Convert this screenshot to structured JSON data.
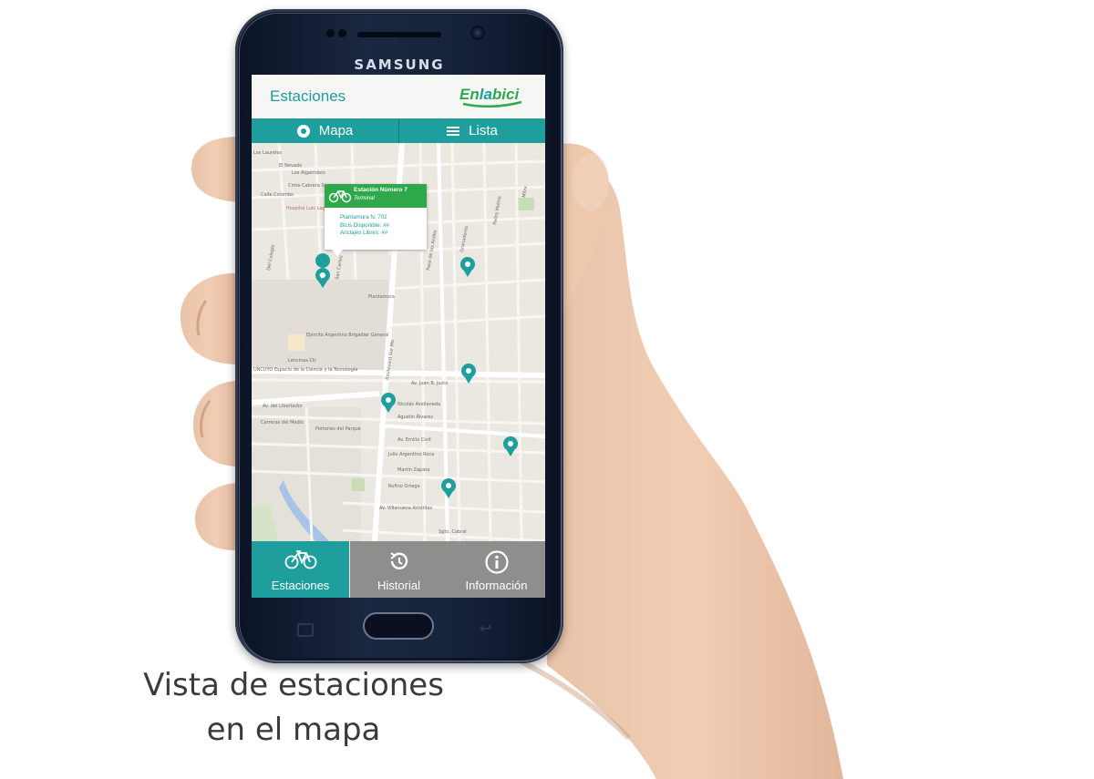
{
  "device": {
    "brand": "SAMSUNG"
  },
  "app": {
    "title": "Estaciones",
    "logo": {
      "part1": "En",
      "part2": "la",
      "part3": "bici"
    },
    "tabs": [
      {
        "label": "Mapa",
        "icon": "map-pin-icon",
        "active": true
      },
      {
        "label": "Lista",
        "icon": "list-icon",
        "active": false
      }
    ],
    "popup": {
      "title": "Estación Número 7",
      "subtitle": "Terminal",
      "address": "Plantamura N. 702",
      "bikes": "Bicis Disponible: ##",
      "docks": "Anclajes Libres: ##"
    },
    "bottom_nav": [
      {
        "label": "Estaciones",
        "icon": "bicycle-icon",
        "active": true
      },
      {
        "label": "Historial",
        "icon": "history-icon",
        "active": false
      },
      {
        "label": "Información",
        "icon": "info-icon",
        "active": false
      }
    ]
  },
  "map": {
    "streets": [
      "Los Laureles",
      "El Nevado",
      "Los Algarrobos",
      "Cmte Cabrera Sur",
      "Calle Colombo",
      "Hospital Luis Lagomaggiore",
      "Del Colegio",
      "San Carlos",
      "Plantamura",
      "Ejército Argentino Brigadier General",
      "Lencinas Ctr",
      "UNCUYO Espacio de la Ciencia y la Tecnología",
      "Av. del Libertador",
      "Carreras del Medio",
      "Portones del Parque",
      "Boulevard Sur Mo",
      "Paso de los Andes",
      "Av. Juan B. Justo",
      "Nicolás Avellaneda",
      "Agustín Álvarez",
      "Av. Emilio Civit",
      "Julio Argentino Roca",
      "Martín Zapata",
      "Rufino Ortega",
      "Av. Villanueva Arístides",
      "Sgto. Cabral",
      "Granaderos",
      "Pedro Molina",
      "Mitre"
    ]
  },
  "colors": {
    "teal": "#1e9e9d",
    "green": "#2fa84c",
    "gray": "#8e8e8c"
  },
  "caption": {
    "line1": "Vista de estaciones",
    "line2": "en el mapa"
  }
}
